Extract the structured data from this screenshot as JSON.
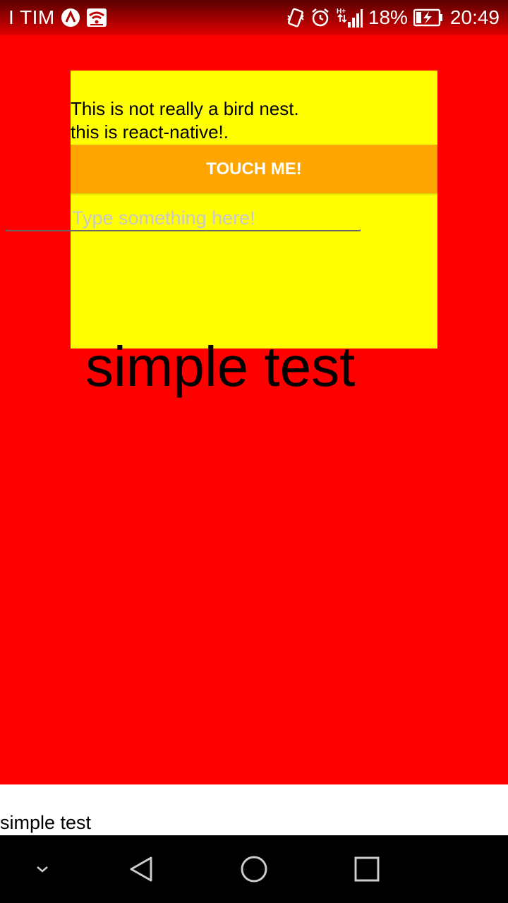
{
  "status_bar": {
    "carrier": "I TIM",
    "network_type": "H+",
    "battery_percent": "18%",
    "time": "20:49",
    "icons": [
      "app-a-icon",
      "wifi-icon",
      "vibrate-icon",
      "alarm-icon",
      "signal-icon",
      "battery-charging-icon"
    ]
  },
  "card": {
    "intro_text": "This is not really a bird nest.\n this is react-native!.",
    "button_label": "TOUCH ME!",
    "input_placeholder": "Type something here!",
    "input_value": "",
    "big_text": "simple test"
  },
  "bottom_bar": {
    "text": "simple test"
  },
  "nav_bar": {
    "icons": [
      "chevron-down-icon",
      "back-icon",
      "home-icon",
      "recents-icon"
    ]
  },
  "colors": {
    "background": "#ff0000",
    "card": "#ffff00",
    "button": "#ffa500",
    "bottom_bar": "#ffffff",
    "nav_bar": "#000000"
  }
}
